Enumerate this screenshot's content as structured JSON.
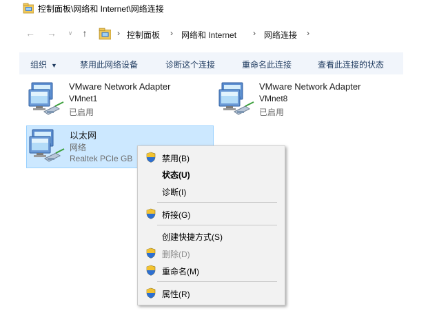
{
  "window": {
    "title": "控制面板\\网络和 Internet\\网络连接"
  },
  "address": {
    "crumbs": [
      "控制面板",
      "网络和 Internet",
      "网络连接"
    ]
  },
  "toolbar": {
    "organize": "组织",
    "disable_device": "禁用此网络设备",
    "diagnose": "诊断这个连接",
    "rename": "重命名此连接",
    "view_status": "查看此连接的状态"
  },
  "adapters": [
    {
      "name": "VMware Network Adapter",
      "sub": "VMnet1",
      "status": "已启用"
    },
    {
      "name": "VMware Network Adapter",
      "sub": "VMnet8",
      "status": "已启用"
    },
    {
      "name": "以太网",
      "sub": "网络",
      "status": "Realtek PCIe GB"
    }
  ],
  "context_menu": {
    "items": [
      {
        "label": "禁用(B)",
        "shield": true
      },
      {
        "label": "状态(U)",
        "bold": true
      },
      {
        "label": "诊断(I)"
      },
      {
        "label": "桥接(G)",
        "shield": true
      },
      {
        "label": "创建快捷方式(S)"
      },
      {
        "label": "删除(D)",
        "shield": true,
        "disabled": true
      },
      {
        "label": "重命名(M)",
        "shield": true
      },
      {
        "label": "属性(R)",
        "shield": true
      }
    ]
  }
}
